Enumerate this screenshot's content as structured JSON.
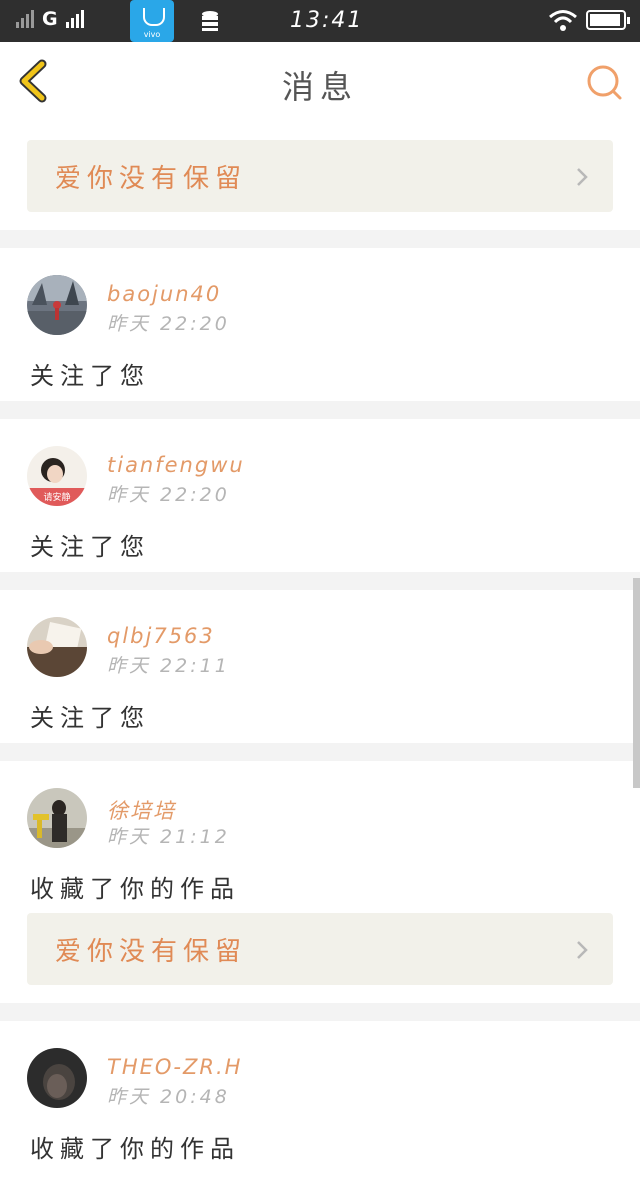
{
  "status_bar": {
    "network": "G",
    "store_icon_label": "vivo",
    "time": "13:41"
  },
  "header": {
    "title": "消息"
  },
  "top_work": {
    "title": "爱你没有保留"
  },
  "messages": [
    {
      "username": "baojun40",
      "time": "昨天 22:20",
      "action": "关注了您"
    },
    {
      "username": "tianfengwu",
      "time": "昨天 22:20",
      "action": "关注了您",
      "avatar_badge": "请安静"
    },
    {
      "username": "qlbj7563",
      "time": "昨天 22:11",
      "action": "关注了您"
    },
    {
      "username": "徐培培",
      "time": "昨天 21:12",
      "action": "收藏了你的作品",
      "work_title": "爱你没有保留"
    },
    {
      "username": "THEO-ZR.H",
      "time": "昨天 20:48",
      "action": "收藏了你的作品"
    }
  ],
  "colors": {
    "accent": "#e08a55",
    "icon_yellow": "#f0c419",
    "work_box_bg": "#f2f1ea",
    "status_bar_bg": "#2f2f2f"
  }
}
